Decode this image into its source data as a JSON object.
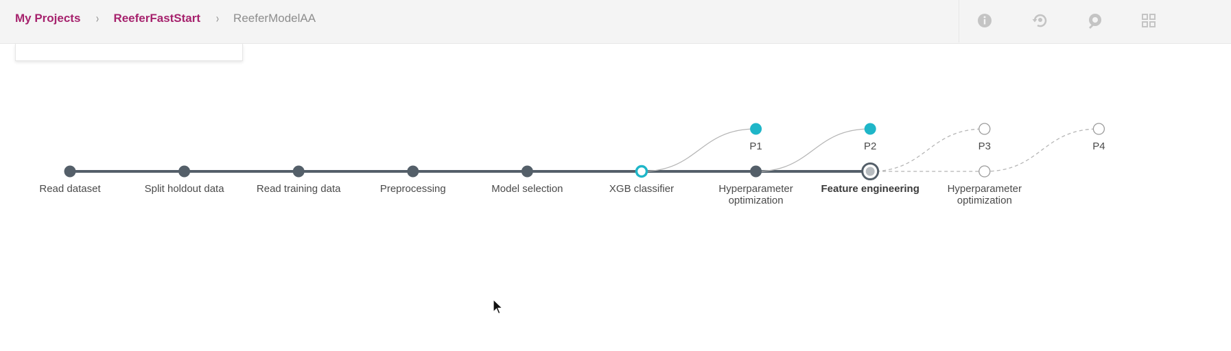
{
  "breadcrumb": {
    "items": [
      "My Projects",
      "ReeferFastStart"
    ],
    "current": "ReeferModelAA",
    "separator": "›"
  },
  "toolbar": {
    "icons": [
      "info-icon",
      "history-icon",
      "palette-icon",
      "grid-icon"
    ]
  },
  "colors": {
    "accent": "#a6226d",
    "teal": "#1fb6c8",
    "node_dark": "#545f69",
    "line_dark": "#545f69",
    "line_light": "#b5b5b5"
  },
  "pipeline": {
    "main_steps": [
      {
        "label": "Read dataset",
        "state": "done"
      },
      {
        "label": "Split holdout data",
        "state": "done"
      },
      {
        "label": "Read training data",
        "state": "done"
      },
      {
        "label": "Preprocessing",
        "state": "done"
      },
      {
        "label": "Model selection",
        "state": "done"
      },
      {
        "label": "XGB classifier",
        "state": "branch-point"
      },
      {
        "label": "Hyperparameter\noptimization",
        "state": "done"
      },
      {
        "label": "Feature engineering",
        "state": "current"
      },
      {
        "label": "Hyperparameter\noptimization",
        "state": "pending"
      }
    ],
    "pipelines": [
      {
        "label": "P1",
        "state": "active"
      },
      {
        "label": "P2",
        "state": "active"
      },
      {
        "label": "P3",
        "state": "pending"
      },
      {
        "label": "P4",
        "state": "pending"
      }
    ]
  }
}
